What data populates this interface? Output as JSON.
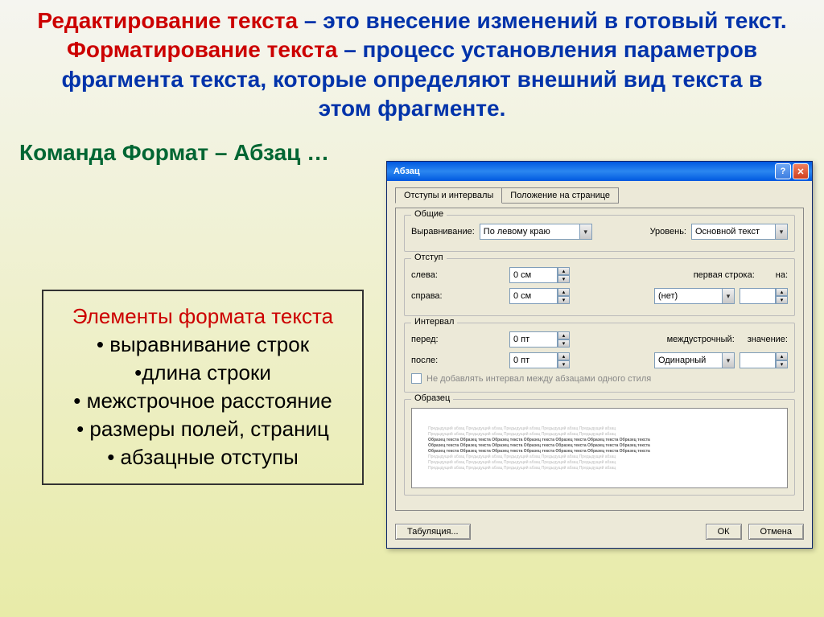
{
  "header": {
    "t1_red": "Редактирование текста",
    "t1_blue": " – это внесение изменений в готовый текст.",
    "t2_red": "Форматирование текста",
    "t2_blue": " – процесс установления параметров фрагмента текста, которые определяют внешний вид текста в этом фрагменте."
  },
  "command": "Команда Формат – Абзац …",
  "elements": {
    "title": "Элементы формата текста",
    "items": [
      "• выравнивание строк",
      "•длина строки",
      "• межстрочное расстояние",
      "• размеры полей, страниц",
      "• абзацные отступы"
    ]
  },
  "dialog": {
    "title": "Абзац",
    "tabs": [
      "Отступы и интервалы",
      "Положение на странице"
    ],
    "groups": {
      "general": {
        "title": "Общие",
        "align_label": "Выравнивание:",
        "align_value": "По левому краю",
        "level_label": "Уровень:",
        "level_value": "Основной текст"
      },
      "indent": {
        "title": "Отступ",
        "left_label": "слева:",
        "left_value": "0 см",
        "right_label": "справа:",
        "right_value": "0 см",
        "first_label": "первая строка:",
        "first_value": "(нет)",
        "by_label": "на:",
        "by_value": ""
      },
      "spacing": {
        "title": "Интервал",
        "before_label": "перед:",
        "before_value": "0 пт",
        "after_label": "после:",
        "after_value": "0 пт",
        "line_label": "междустрочный:",
        "line_value": "Одинарный",
        "at_label": "значение:",
        "at_value": ""
      },
      "checkbox": "Не добавлять интервал между абзацами одного стиля",
      "preview": {
        "title": "Образец",
        "light": "Предыдущий абзац Предыдущий абзац Предыдущий абзац Предыдущий абзац Предыдущий абзац",
        "dark": "Образец текста Образец текста Образец текста Образец текста Образец текста Образец текста Образец текста"
      }
    },
    "buttons": {
      "tabs": "Табуляция...",
      "ok": "ОК",
      "cancel": "Отмена"
    }
  }
}
